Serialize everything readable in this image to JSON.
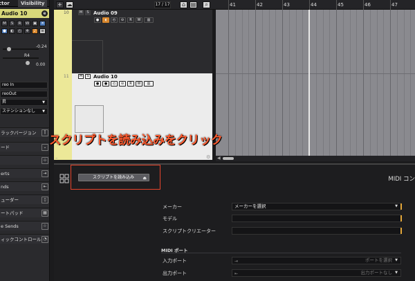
{
  "inspector": {
    "tabs": [
      "ctor",
      "Visibility"
    ],
    "track_name": "Audio 10",
    "edit_label": "e",
    "values": [
      "-0.24",
      "R4",
      "0.00"
    ],
    "input": "reo In",
    "output": "reoOut",
    "drop1": "昇",
    "drop2": "ステンションなし",
    "sections": [
      {
        "label": "ラックバージョン",
        "icon": "versions-icon"
      },
      {
        "label": "ード",
        "icon": "chevron-down-icon"
      },
      {
        "label": "",
        "icon": "plus-diamond-icon"
      },
      {
        "label": "erts",
        "icon": "inserts-icon"
      },
      {
        "label": "nds",
        "icon": "sends-icon"
      },
      {
        "label": "ューダー",
        "icon": "fader-icon"
      },
      {
        "label": "ートパッド",
        "icon": "pad-icon"
      },
      {
        "label": "e Sends",
        "icon": "star-icon"
      },
      {
        "label": "ィックコントロール",
        "icon": "quick-controls-icon"
      }
    ]
  },
  "toolbar": {
    "add": "+",
    "counter": "17 / 17"
  },
  "tracks": [
    {
      "number": "10",
      "name": "Audio 09"
    },
    {
      "number": "11",
      "name": "Audio 10"
    }
  ],
  "track_buttons": {
    "m": "M",
    "s": "S",
    "r": "R",
    "w": "W"
  },
  "ruler": {
    "bars": [
      "41",
      "42",
      "43",
      "44",
      "45",
      "46",
      "47"
    ]
  },
  "panel": {
    "load_button": "スクリプトを読み込み",
    "title": "MIDI コン",
    "fields": [
      {
        "label": "メーカー",
        "value": "メーカーを選択"
      },
      {
        "label": "モデル",
        "value": ""
      },
      {
        "label": "スクリプトクリエーター",
        "value": ""
      }
    ],
    "ports_heading": "MIDI ポート",
    "ports": [
      {
        "label": "入力ポート",
        "value": "ポートを選択"
      },
      {
        "label": "出力ポート",
        "value": "出力ポートなし"
      }
    ]
  },
  "annotation": {
    "text": "スクリプトを読み込みをクリック"
  },
  "colors": {
    "track_yellow": "#ece898",
    "accent_orange": "#d9882e",
    "annotation_red": "#ff5a2e",
    "field_marker": "#e6a93a"
  }
}
